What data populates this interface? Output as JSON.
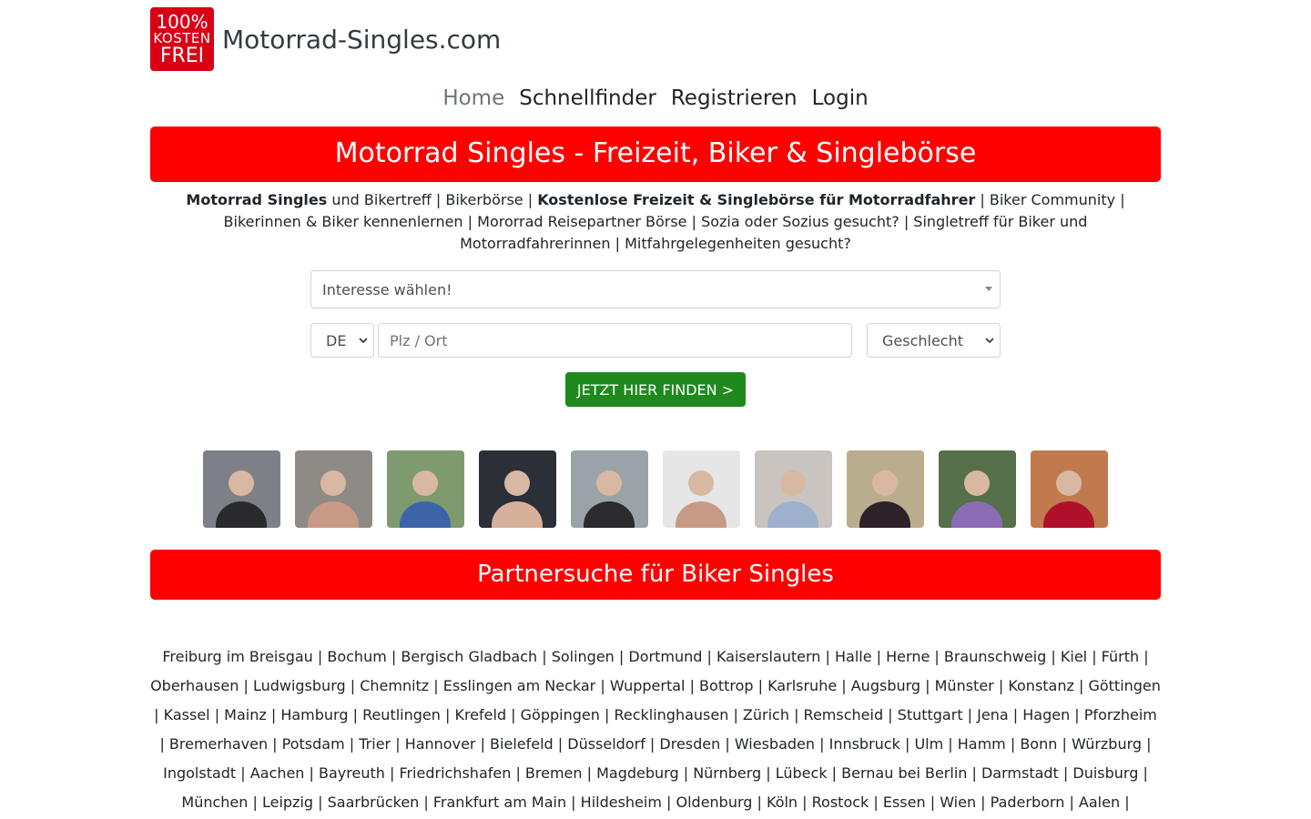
{
  "header": {
    "logo_line1": "100%",
    "logo_line2": "KOSTEN",
    "logo_line3": "FREI",
    "site_name": "Motorrad-Singles.com"
  },
  "nav": [
    {
      "label": "Home",
      "active": true
    },
    {
      "label": "Schnellfinder",
      "active": false
    },
    {
      "label": "Registrieren",
      "active": false
    },
    {
      "label": "Login",
      "active": false
    }
  ],
  "hero": {
    "title": "Motorrad Singles - Freizeit, Biker & Singlebörse",
    "intro_bold1": "Motorrad Singles",
    "intro_text1": " und Bikertreff | Bikerbörse | ",
    "intro_bold2": "Kostenlose Freizeit & Singlebörse für Motorradfahrer",
    "intro_text2": " | Biker Community | Bikerinnen & Biker kennenlernen | Mororrad Reisepartner Börse | Sozia oder Sozius gesucht? | Singletreff für Biker und Motorradfahrerinnen | Mitfahrgelegenheiten gesucht?"
  },
  "search": {
    "interest_placeholder": "Interesse wählen!",
    "country_value": "DE",
    "plz_placeholder": "Plz / Ort",
    "gender_value": "Geschlecht",
    "submit_label": "JETZT HIER FINDEN >"
  },
  "photos": [
    {
      "name": "profile-photo-1",
      "bg": "#7d8086",
      "fg": "#2a2a2e"
    },
    {
      "name": "profile-photo-2",
      "bg": "#8e8a86",
      "fg": "#c89a86"
    },
    {
      "name": "profile-photo-3",
      "bg": "#7f9a6f",
      "fg": "#3d63a8"
    },
    {
      "name": "profile-photo-4",
      "bg": "#2a2f38",
      "fg": "#d6b09a"
    },
    {
      "name": "profile-photo-5",
      "bg": "#9aa3a8",
      "fg": "#2b2b2f"
    },
    {
      "name": "profile-photo-6",
      "bg": "#e6e6e6",
      "fg": "#c79a86"
    },
    {
      "name": "profile-photo-7",
      "bg": "#c9c4bf",
      "fg": "#9fb0cc"
    },
    {
      "name": "profile-photo-8",
      "bg": "#b9ad8e",
      "fg": "#2c2228"
    },
    {
      "name": "profile-photo-9",
      "bg": "#55704a",
      "fg": "#8a6db5"
    },
    {
      "name": "profile-photo-10",
      "bg": "#c07a4e",
      "fg": "#b0102a"
    }
  ],
  "section2": {
    "title": "Partnersuche für Biker Singles"
  },
  "cities": [
    "Freiburg im Breisgau",
    "Bochum",
    "Bergisch Gladbach",
    "Solingen",
    "Dortmund",
    "Kaiserslautern",
    "Halle",
    "Herne",
    "Braunschweig",
    "Kiel",
    "Fürth",
    "Oberhausen",
    "Ludwigsburg",
    "Chemnitz",
    "Esslingen am Neckar",
    "Wuppertal",
    "Bottrop",
    "Karlsruhe",
    "Augsburg",
    "Münster",
    "Konstanz",
    "Göttingen",
    "Kassel",
    "Mainz",
    "Hamburg",
    "Reutlingen",
    "Krefeld",
    "Göppingen",
    "Recklinghausen",
    "Zürich",
    "Remscheid",
    "Stuttgart",
    "Jena",
    "Hagen",
    "Pforzheim",
    "Bremerhaven",
    "Potsdam",
    "Trier",
    "Hannover",
    "Bielefeld",
    "Düsseldorf",
    "Dresden",
    "Wiesbaden",
    "Innsbruck",
    "Ulm",
    "Hamm",
    "Bonn",
    "Würzburg",
    "Ingolstadt",
    "Aachen",
    "Bayreuth",
    "Friedrichshafen",
    "Bremen",
    "Magdeburg",
    "Nürnberg",
    "Lübeck",
    "Bernau bei Berlin",
    "Darmstadt",
    "Duisburg",
    "München",
    "Leipzig",
    "Saarbrücken",
    "Frankfurt am Main",
    "Hildesheim",
    "Oldenburg",
    "Köln",
    "Rostock",
    "Essen",
    "Wien",
    "Paderborn",
    "Aalen"
  ]
}
